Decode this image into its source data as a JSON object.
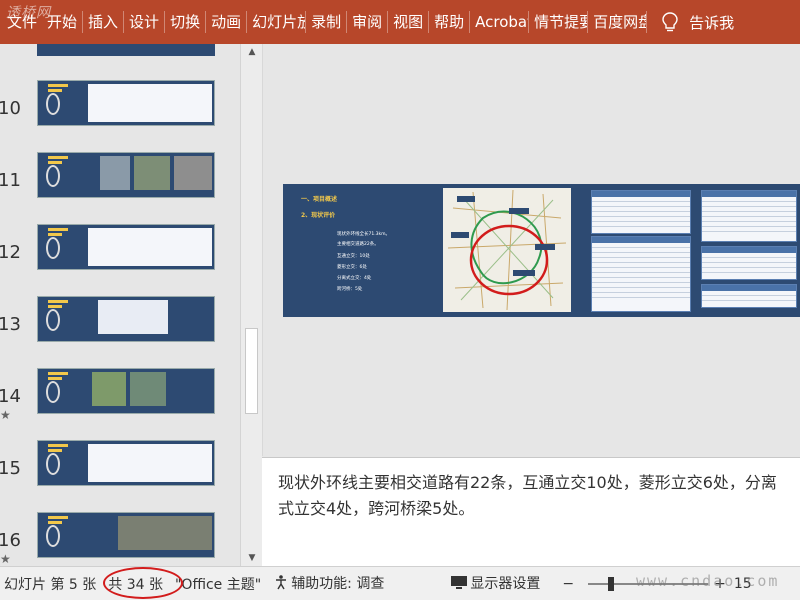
{
  "ribbon": {
    "tabs": [
      "文件",
      "开始",
      "插入",
      "设计",
      "切换",
      "动画",
      "幻灯片放映",
      "录制",
      "审阅",
      "视图",
      "帮助",
      "Acrobat",
      "情节提要",
      "百度网盘"
    ],
    "tell_me": "告诉我",
    "watermark": "透桥网",
    "accent_color": "#b7472a"
  },
  "thumbnails": {
    "items": [
      {
        "number": "10",
        "star": ""
      },
      {
        "number": "11",
        "star": ""
      },
      {
        "number": "12",
        "star": ""
      },
      {
        "number": "13",
        "star": ""
      },
      {
        "number": "14",
        "star": "★"
      },
      {
        "number": "15",
        "star": ""
      },
      {
        "number": "16",
        "star": "★"
      }
    ]
  },
  "slide": {
    "heading1": "一、项目概述",
    "heading2": "2、现状评价",
    "lines": [
      "现状外环线全长71.3km。",
      "主要相交道路22条。",
      "互通立交：10处",
      "菱形立交：6处",
      "分离式立交：4处",
      "跨河桥：5处"
    ],
    "theme_color": "#2d4a72"
  },
  "notes": {
    "text": "现状外环线主要相交道路有22条，互通立交10处，菱形立交6处，分离式立交4处，跨河桥梁5处。"
  },
  "status": {
    "slide_info": "幻灯片 第 5 张",
    "total": "共 34 张",
    "theme": "\"Office 主题\"",
    "accessibility": "辅助功能: 调查",
    "display_settings": "显示器设置",
    "zoom_minus": "−",
    "zoom_plus": "+",
    "zoom_value": "15",
    "watermark": "www.cndao.com"
  }
}
